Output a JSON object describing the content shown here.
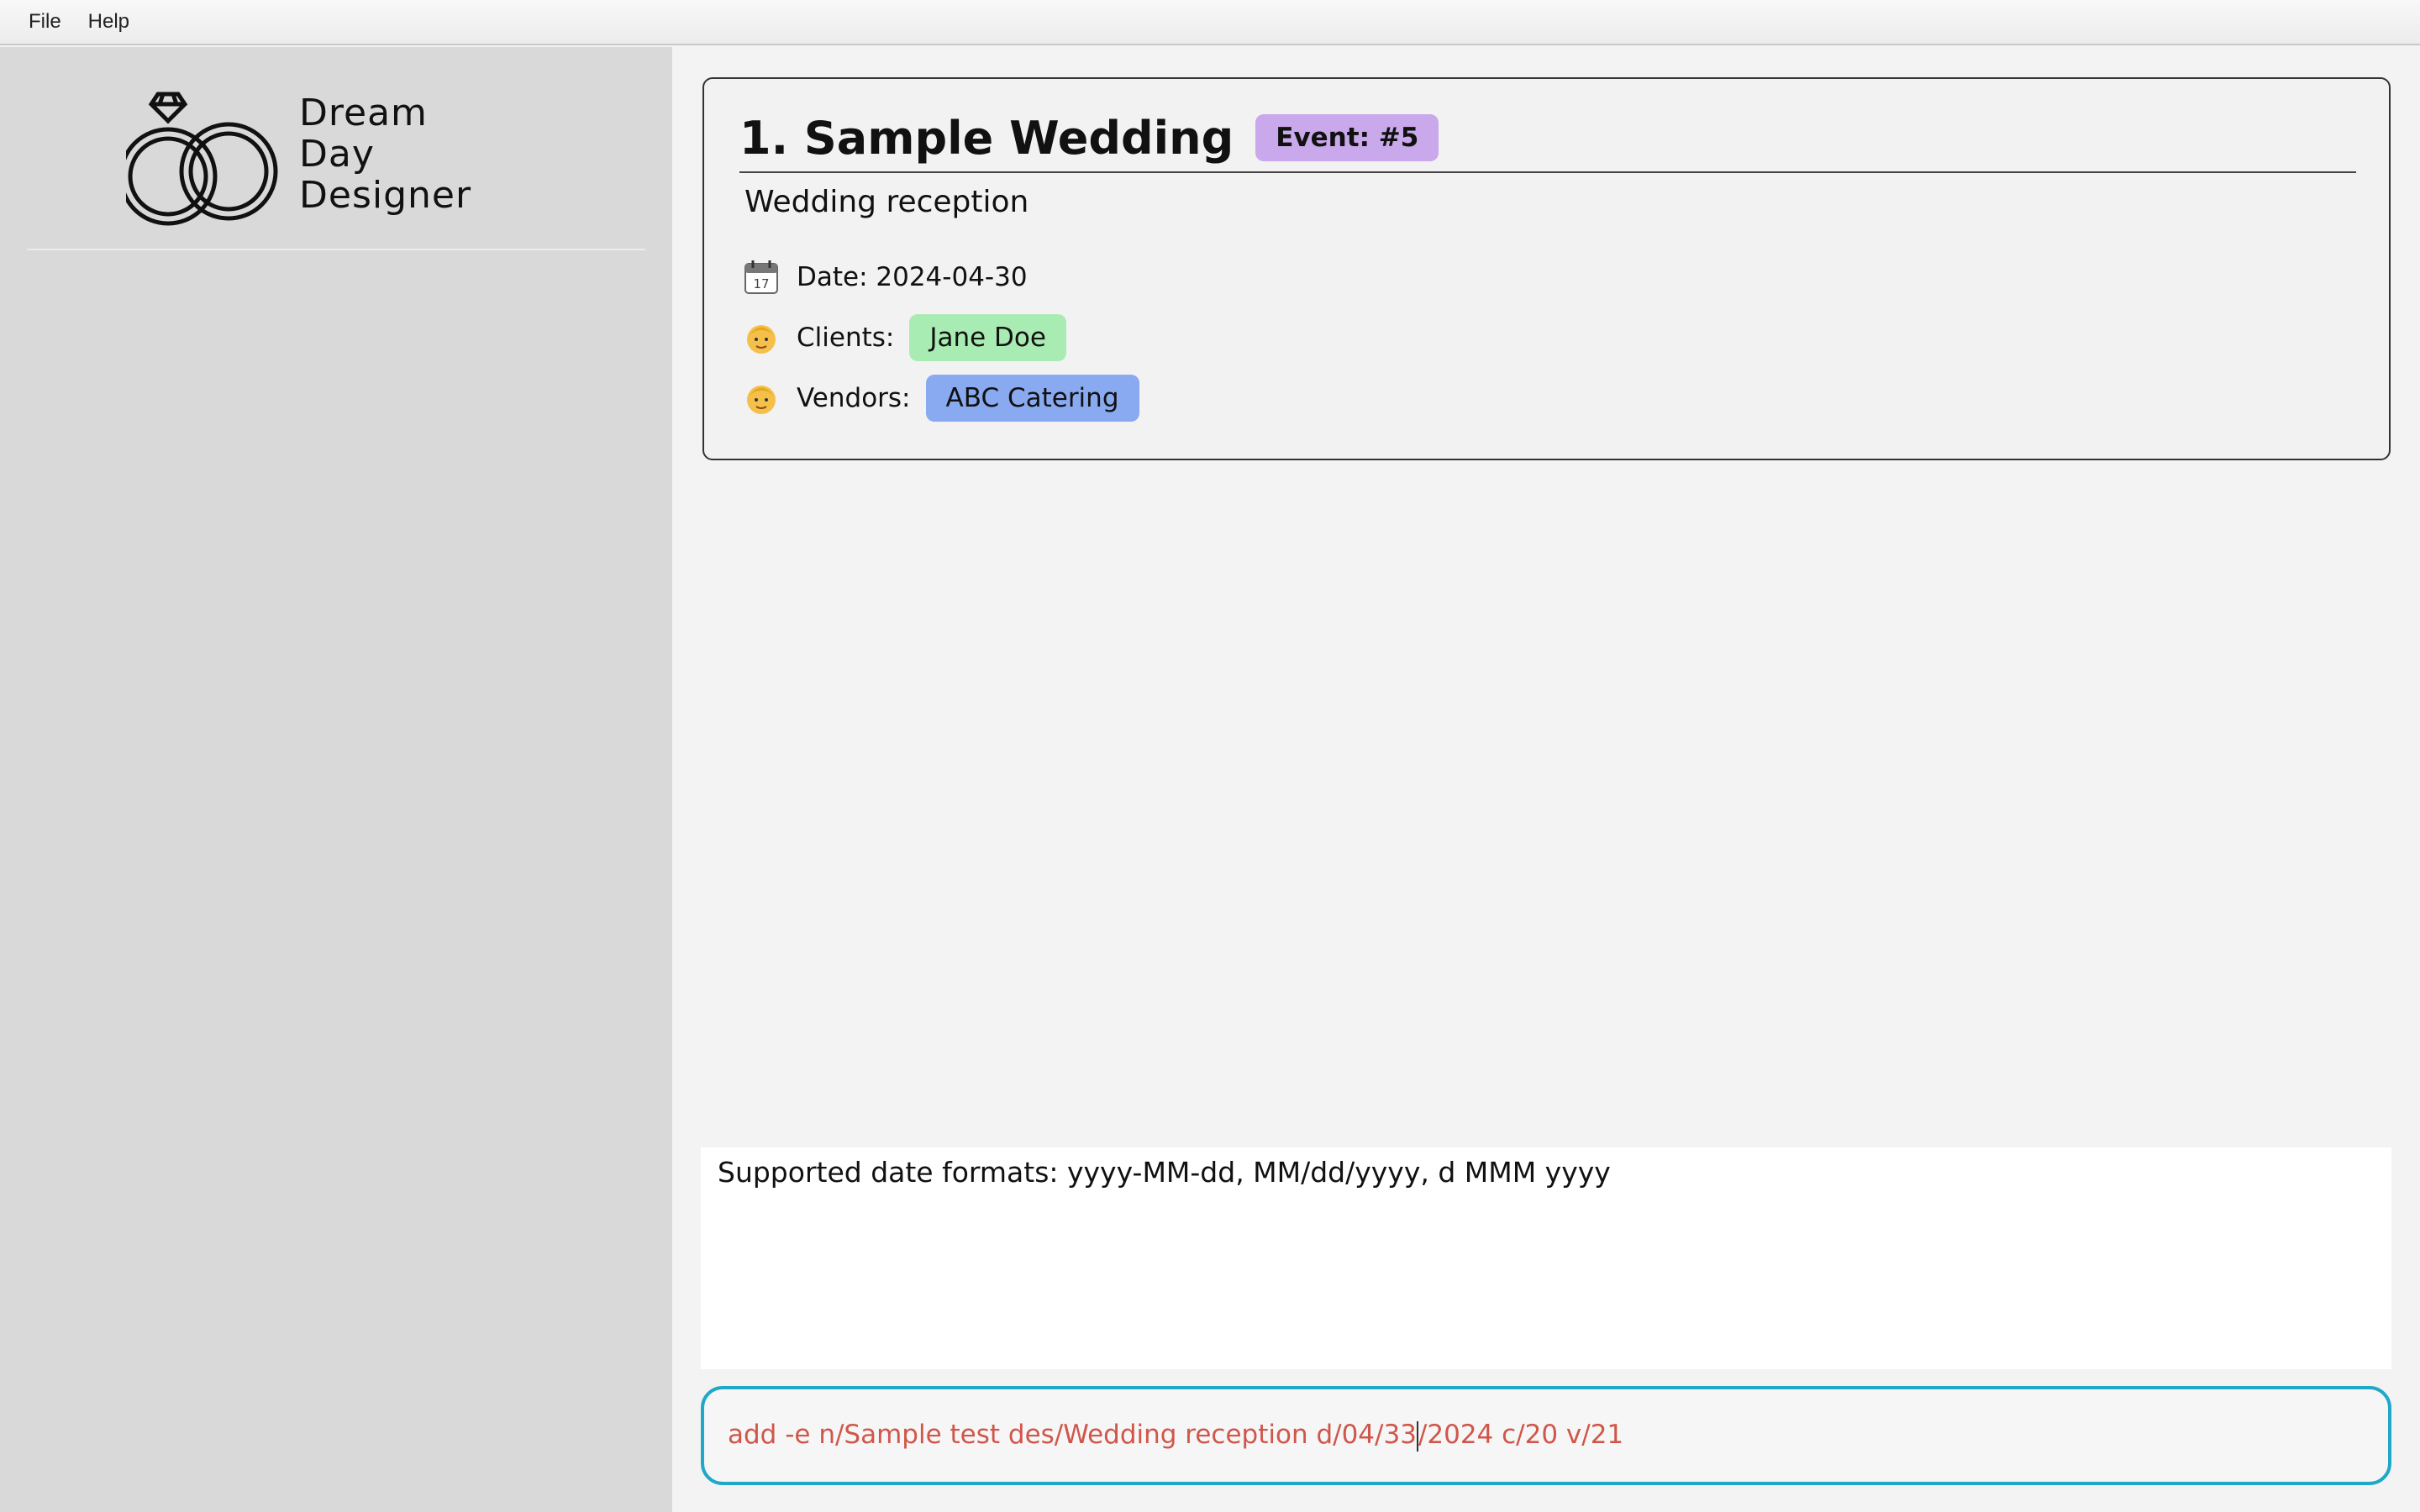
{
  "menubar": {
    "items": [
      "File",
      "Help"
    ]
  },
  "sidebar": {
    "logo": {
      "icon": "wedding-rings-icon",
      "lines": [
        "Dream",
        "Day",
        "Designer"
      ]
    }
  },
  "event_card": {
    "title": "1. Sample Wedding",
    "badge": "Event: #5",
    "description": "Wedding reception",
    "date": {
      "icon": "calendar-icon",
      "label": "Date: 2024-04-30"
    },
    "clients": {
      "icon": "person-icon",
      "label": "Clients:",
      "chips": [
        "Jane Doe"
      ]
    },
    "vendors": {
      "icon": "person-icon",
      "label": "Vendors:",
      "chips": [
        "ABC Catering"
      ]
    }
  },
  "result": {
    "text": "Supported date formats: yyyy-MM-dd, MM/dd/yyyy, d MMM yyyy"
  },
  "command": {
    "before_caret": "add -e n/Sample test des/Wedding reception d/04/33",
    "after_caret": "/2024 c/20 v/21"
  },
  "colors": {
    "badge": "#c9a8ec",
    "client_chip": "#a9ecb3",
    "vendor_chip": "#89aaf0",
    "command_error_text": "#d0564a",
    "command_border": "#20a8c8"
  }
}
